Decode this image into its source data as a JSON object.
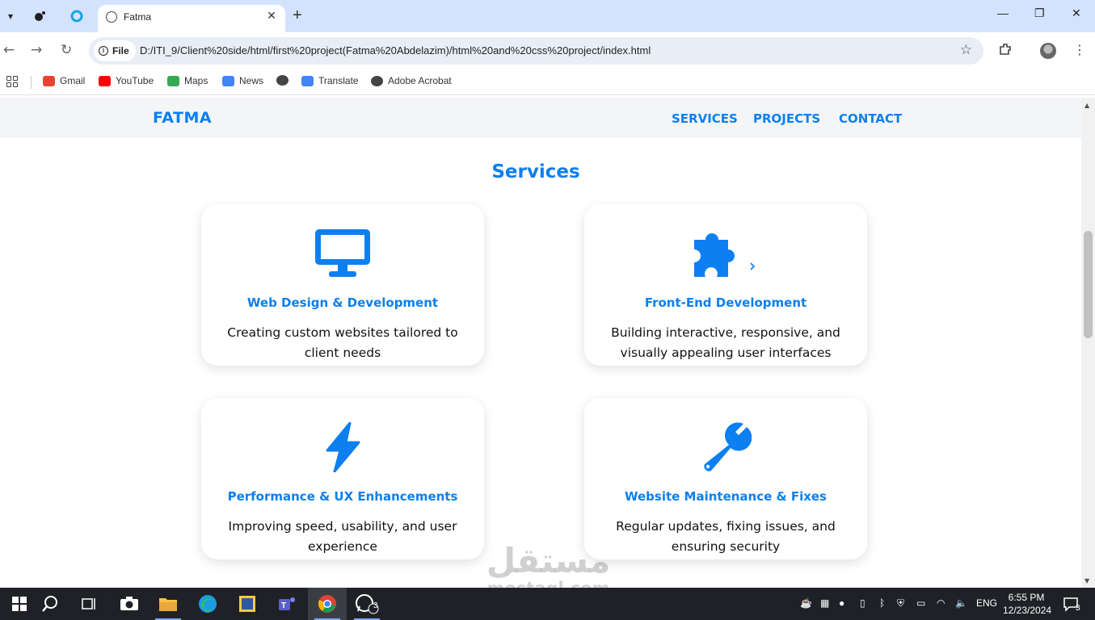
{
  "browser": {
    "tab_title": "Fatma",
    "url_chip": "File",
    "url": "D:/ITI_9/Client%20side/html/first%20project(Fatma%20Abdelazim)/html%20and%20css%20project/index.html"
  },
  "bookmarks": [
    {
      "label": "Gmail",
      "color": "#ea4335"
    },
    {
      "label": "YouTube",
      "color": "#ff0000"
    },
    {
      "label": "Maps",
      "color": "#34a853"
    },
    {
      "label": "News",
      "color": "#4285f4"
    },
    {
      "label": "",
      "color": "#444444"
    },
    {
      "label": "Translate",
      "color": "#4285f4"
    },
    {
      "label": "Adobe Acrobat",
      "color": "#444444"
    }
  ],
  "site": {
    "logo": "FATMA",
    "nav": [
      "SERVICES",
      "PROJECTS",
      "CONTACT"
    ],
    "section_title": "Services",
    "accent_color": "#0d7ff0",
    "cards": [
      {
        "icon": "monitor-icon",
        "title": "Web Design & Development",
        "desc": "Creating custom websites tailored to client needs"
      },
      {
        "icon": "puzzle-icon",
        "title": "Front-End Development",
        "desc": "Building interactive, responsive, and visually appealing user interfaces"
      },
      {
        "icon": "lightning-icon",
        "title": "Performance & UX Enhancements",
        "desc": "Improving speed, usability, and user experience"
      },
      {
        "icon": "wrench-icon",
        "title": "Website Maintenance & Fixes",
        "desc": "Regular updates, fixing issues, and ensuring security"
      }
    ]
  },
  "watermark": {
    "arabic": "مستقل",
    "latin": "mostaql.com"
  },
  "taskbar": {
    "language": "ENG",
    "time": "6:55 PM",
    "date": "12/23/2024",
    "whatsapp_badge": "3",
    "notification_count": "3"
  }
}
